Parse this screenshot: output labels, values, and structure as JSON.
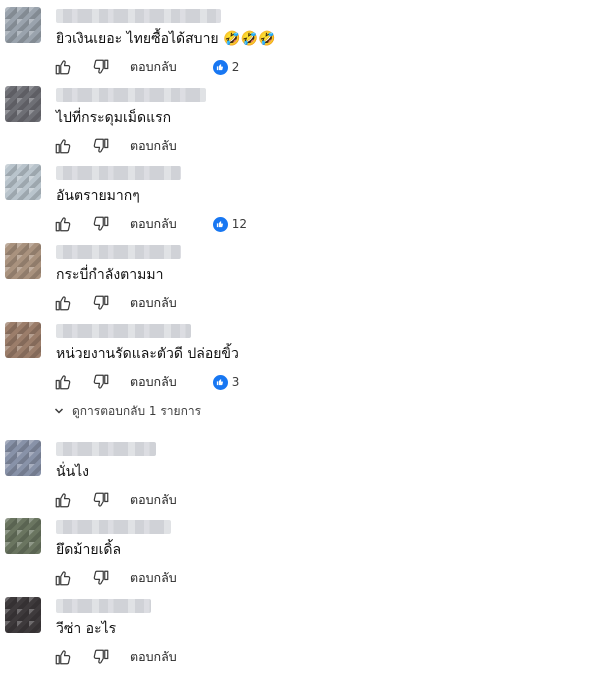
{
  "comments": [
    {
      "text": "ยิวเงินเยอะ ไทยซื้อได้สบาย 🤣🤣🤣",
      "likes": "2",
      "avatar_color": "#9aa3ad"
    },
    {
      "text": "ไปที่กระดุมเม็ดแรก",
      "likes": null,
      "avatar_color": "#6e6f75"
    },
    {
      "text": "อันตรายมากๆ",
      "likes": "12",
      "avatar_color": "#b9c4cc"
    },
    {
      "text": "กระบี่กำลังตามมา",
      "likes": null,
      "avatar_color": "#a9927e"
    },
    {
      "text": "หน่วยงานรัดและตัวดี ปล่อยขิ้ว",
      "likes": "3",
      "avatar_color": "#9b7d6a"
    },
    {
      "text": "นั่นไง",
      "likes": null,
      "avatar_color": "#8892a8"
    },
    {
      "text": "ยึดม้ายเดิ้ล",
      "likes": null,
      "avatar_color": "#6a7560"
    },
    {
      "text": "วีซ่า อะไร",
      "likes": null,
      "avatar_color": "#3e3a3c"
    }
  ],
  "reply_label": "ตอบกลับ",
  "view_replies_label": "ดูการตอบกลับ 1 รายการ",
  "icons": {
    "like": "thumbs-up-icon",
    "dislike": "thumbs-down-icon",
    "like_badge": "blue-like-badge-icon",
    "expand": "chevron-down-icon"
  },
  "colors": {
    "like_badge": "#1877f2",
    "text": "#0f0f0f"
  }
}
